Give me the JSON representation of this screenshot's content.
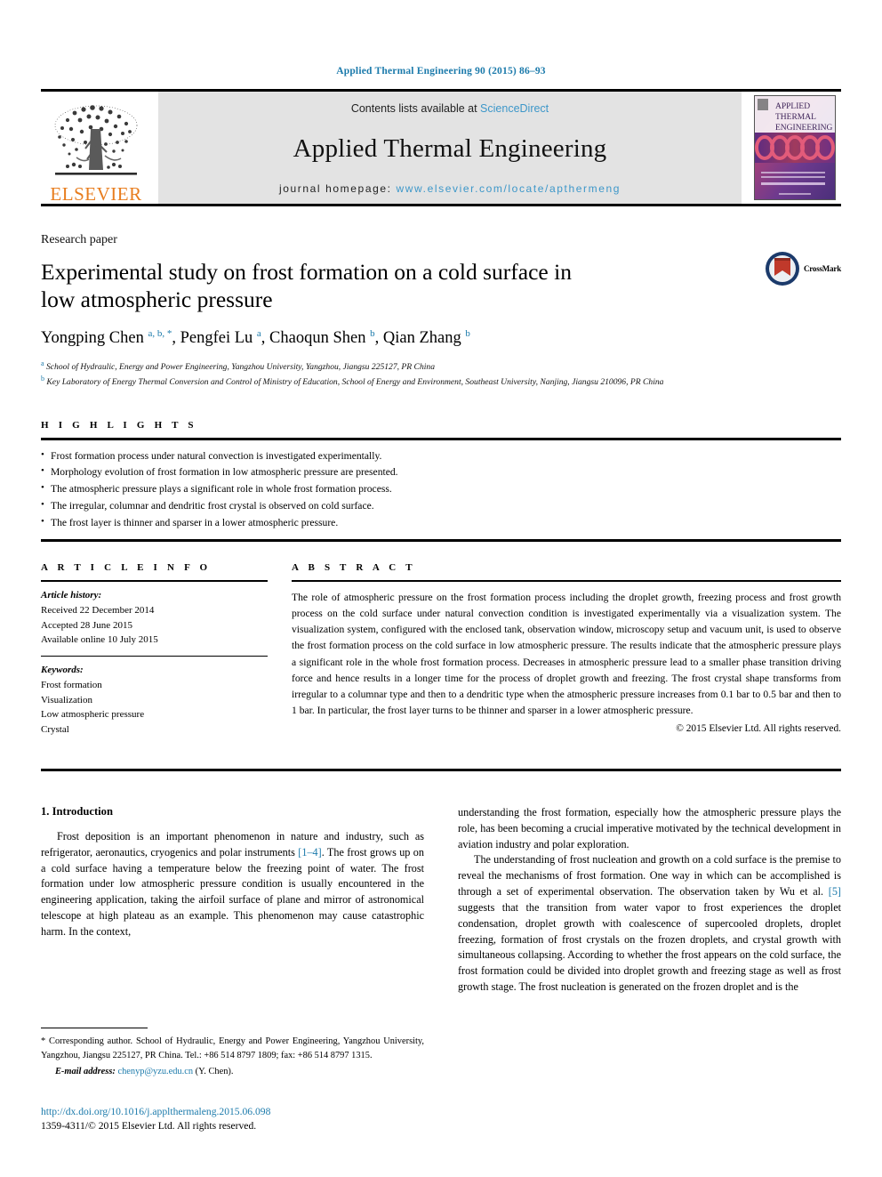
{
  "running_head": "Applied Thermal Engineering 90 (2015) 86–93",
  "masthead": {
    "publisher_name": "ELSEVIER",
    "contents_prefix": "Contents lists available at ",
    "contents_link": "ScienceDirect",
    "journal_title": "Applied Thermal Engineering",
    "homepage_prefix": "journal homepage: ",
    "homepage_url": "www.elsevier.com/locate/apthermeng",
    "cover": {
      "line1": "APPLIED",
      "line2": "THERMAL",
      "line3": "ENGINEERING"
    },
    "accent_link_color": "#3d97c9",
    "elsevier_orange": "#E87D1E"
  },
  "article": {
    "type": "Research paper",
    "title": "Experimental study on frost formation on a cold surface in low atmospheric pressure",
    "authors_html": "Yongping Chen <sup>a, b, *</sup>, Pengfei Lu <sup>a</sup>, Chaoqun Shen <sup>b</sup>, Qian Zhang <sup>b</sup>",
    "affiliation_a": "School of Hydraulic, Energy and Power Engineering, Yangzhou University, Yangzhou, Jiangsu 225127, PR China",
    "affiliation_b": "Key Laboratory of Energy Thermal Conversion and Control of Ministry of Education, School of Energy and Environment, Southeast University, Nanjing, Jiangsu 210096, PR China",
    "crossmark_label": "CrossMark"
  },
  "highlights": {
    "label": "H I G H L I G H T S",
    "items": [
      "Frost formation process under natural convection is investigated experimentally.",
      "Morphology evolution of frost formation in low atmospheric pressure are presented.",
      "The atmospheric pressure plays a significant role in whole frost formation process.",
      "The irregular, columnar and dendritic frost crystal is observed on cold surface.",
      "The frost layer is thinner and sparser in a lower atmospheric pressure."
    ]
  },
  "article_info": {
    "label": "A R T I C L E   I N F O",
    "history_label": "Article history:",
    "history": [
      "Received 22 December 2014",
      "Accepted 28 June 2015",
      "Available online 10 July 2015"
    ],
    "keywords_label": "Keywords:",
    "keywords": [
      "Frost formation",
      "Visualization",
      "Low atmospheric pressure",
      "Crystal"
    ]
  },
  "abstract": {
    "label": "A B S T R A C T",
    "text": "The role of atmospheric pressure on the frost formation process including the droplet growth, freezing process and frost growth process on the cold surface under natural convection condition is investigated experimentally via a visualization system. The visualization system, configured with the enclosed tank, observation window, microscopy setup and vacuum unit, is used to observe the frost formation process on the cold surface in low atmospheric pressure. The results indicate that the atmospheric pressure plays a significant role in the whole frost formation process. Decreases in atmospheric pressure lead to a smaller phase transition driving force and hence results in a longer time for the process of droplet growth and freezing. The frost crystal shape transforms from irregular to a columnar type and then to a dendritic type when the atmospheric pressure increases from 0.1 bar to 0.5 bar and then to 1 bar. In particular, the frost layer turns to be thinner and sparser in a lower atmospheric pressure.",
    "copyright": "© 2015 Elsevier Ltd. All rights reserved."
  },
  "body": {
    "section_number_title": "1.  Introduction",
    "left_paragraph_pre": "Frost deposition is an important phenomenon in nature and industry, such as refrigerator, aeronautics, cryogenics and polar instruments ",
    "left_citation_1": "[1–4]",
    "left_paragraph_post": ". The frost grows up on a cold surface having a temperature below the freezing point of water. The frost formation under low atmospheric pressure condition is usually encountered in the engineering application, taking the airfoil surface of plane and mirror of astronomical telescope at high plateau as an example. This phenomenon may cause catastrophic harm. In the context,",
    "right_paragraph_1": "understanding the frost formation, especially how the atmospheric pressure plays the role, has been becoming a crucial imperative motivated by the technical development in aviation industry and polar exploration.",
    "right_paragraph_2_pre": "The understanding of frost nucleation and growth on a cold surface is the premise to reveal the mechanisms of frost formation. One way in which can be accomplished is through a set of experimental observation. The observation taken by Wu et al. ",
    "right_citation_5": "[5]",
    "right_paragraph_2_post": " suggests that the transition from water vapor to frost experiences the droplet condensation, droplet growth with coalescence of supercooled droplets, droplet freezing, formation of frost crystals on the frozen droplets, and crystal growth with simultaneous collapsing. According to whether the frost appears on the cold surface, the frost formation could be divided into droplet growth and freezing stage as well as frost growth stage. The frost nucleation is generated on the frozen droplet and is the"
  },
  "footnote": {
    "corresponding": "* Corresponding author. School of Hydraulic, Energy and Power Engineering, Yangzhou University, Yangzhou, Jiangsu 225127, PR China. Tel.: +86 514 8797 1809; fax: +86 514 8797 1315.",
    "email_label": "E-mail address:",
    "email": "chenyp@yzu.edu.cn",
    "email_suffix": "(Y. Chen)."
  },
  "doi": {
    "url": "http://dx.doi.org/10.1016/j.applthermaleng.2015.06.098",
    "issn_line": "1359-4311/© 2015 Elsevier Ltd. All rights reserved."
  }
}
